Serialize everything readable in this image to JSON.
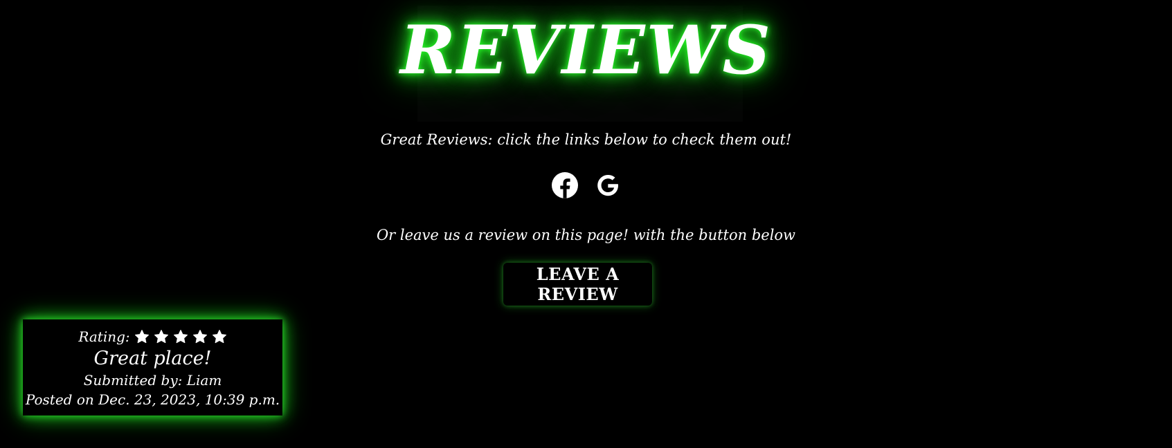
{
  "page": {
    "title": "REVIEWS",
    "intro_text": "Great Reviews: click the links below to check them out!",
    "alt_text": "Or leave us a review on this page! with the button below",
    "leave_review_label": "LEAVE A REVIEW"
  },
  "social_links": [
    {
      "name": "facebook",
      "icon": "facebook-icon"
    },
    {
      "name": "google",
      "icon": "google-icon"
    }
  ],
  "review": {
    "rating_label": "Rating:",
    "rating_value": 5,
    "rating_max": 5,
    "title": "Great place!",
    "author_line": "Submitted by: Liam",
    "date_line": "Posted on Dec. 23, 2023, 10:39 p.m."
  },
  "colors": {
    "background": "#000000",
    "glow": "#1fd11f",
    "text": "#ffffff"
  }
}
